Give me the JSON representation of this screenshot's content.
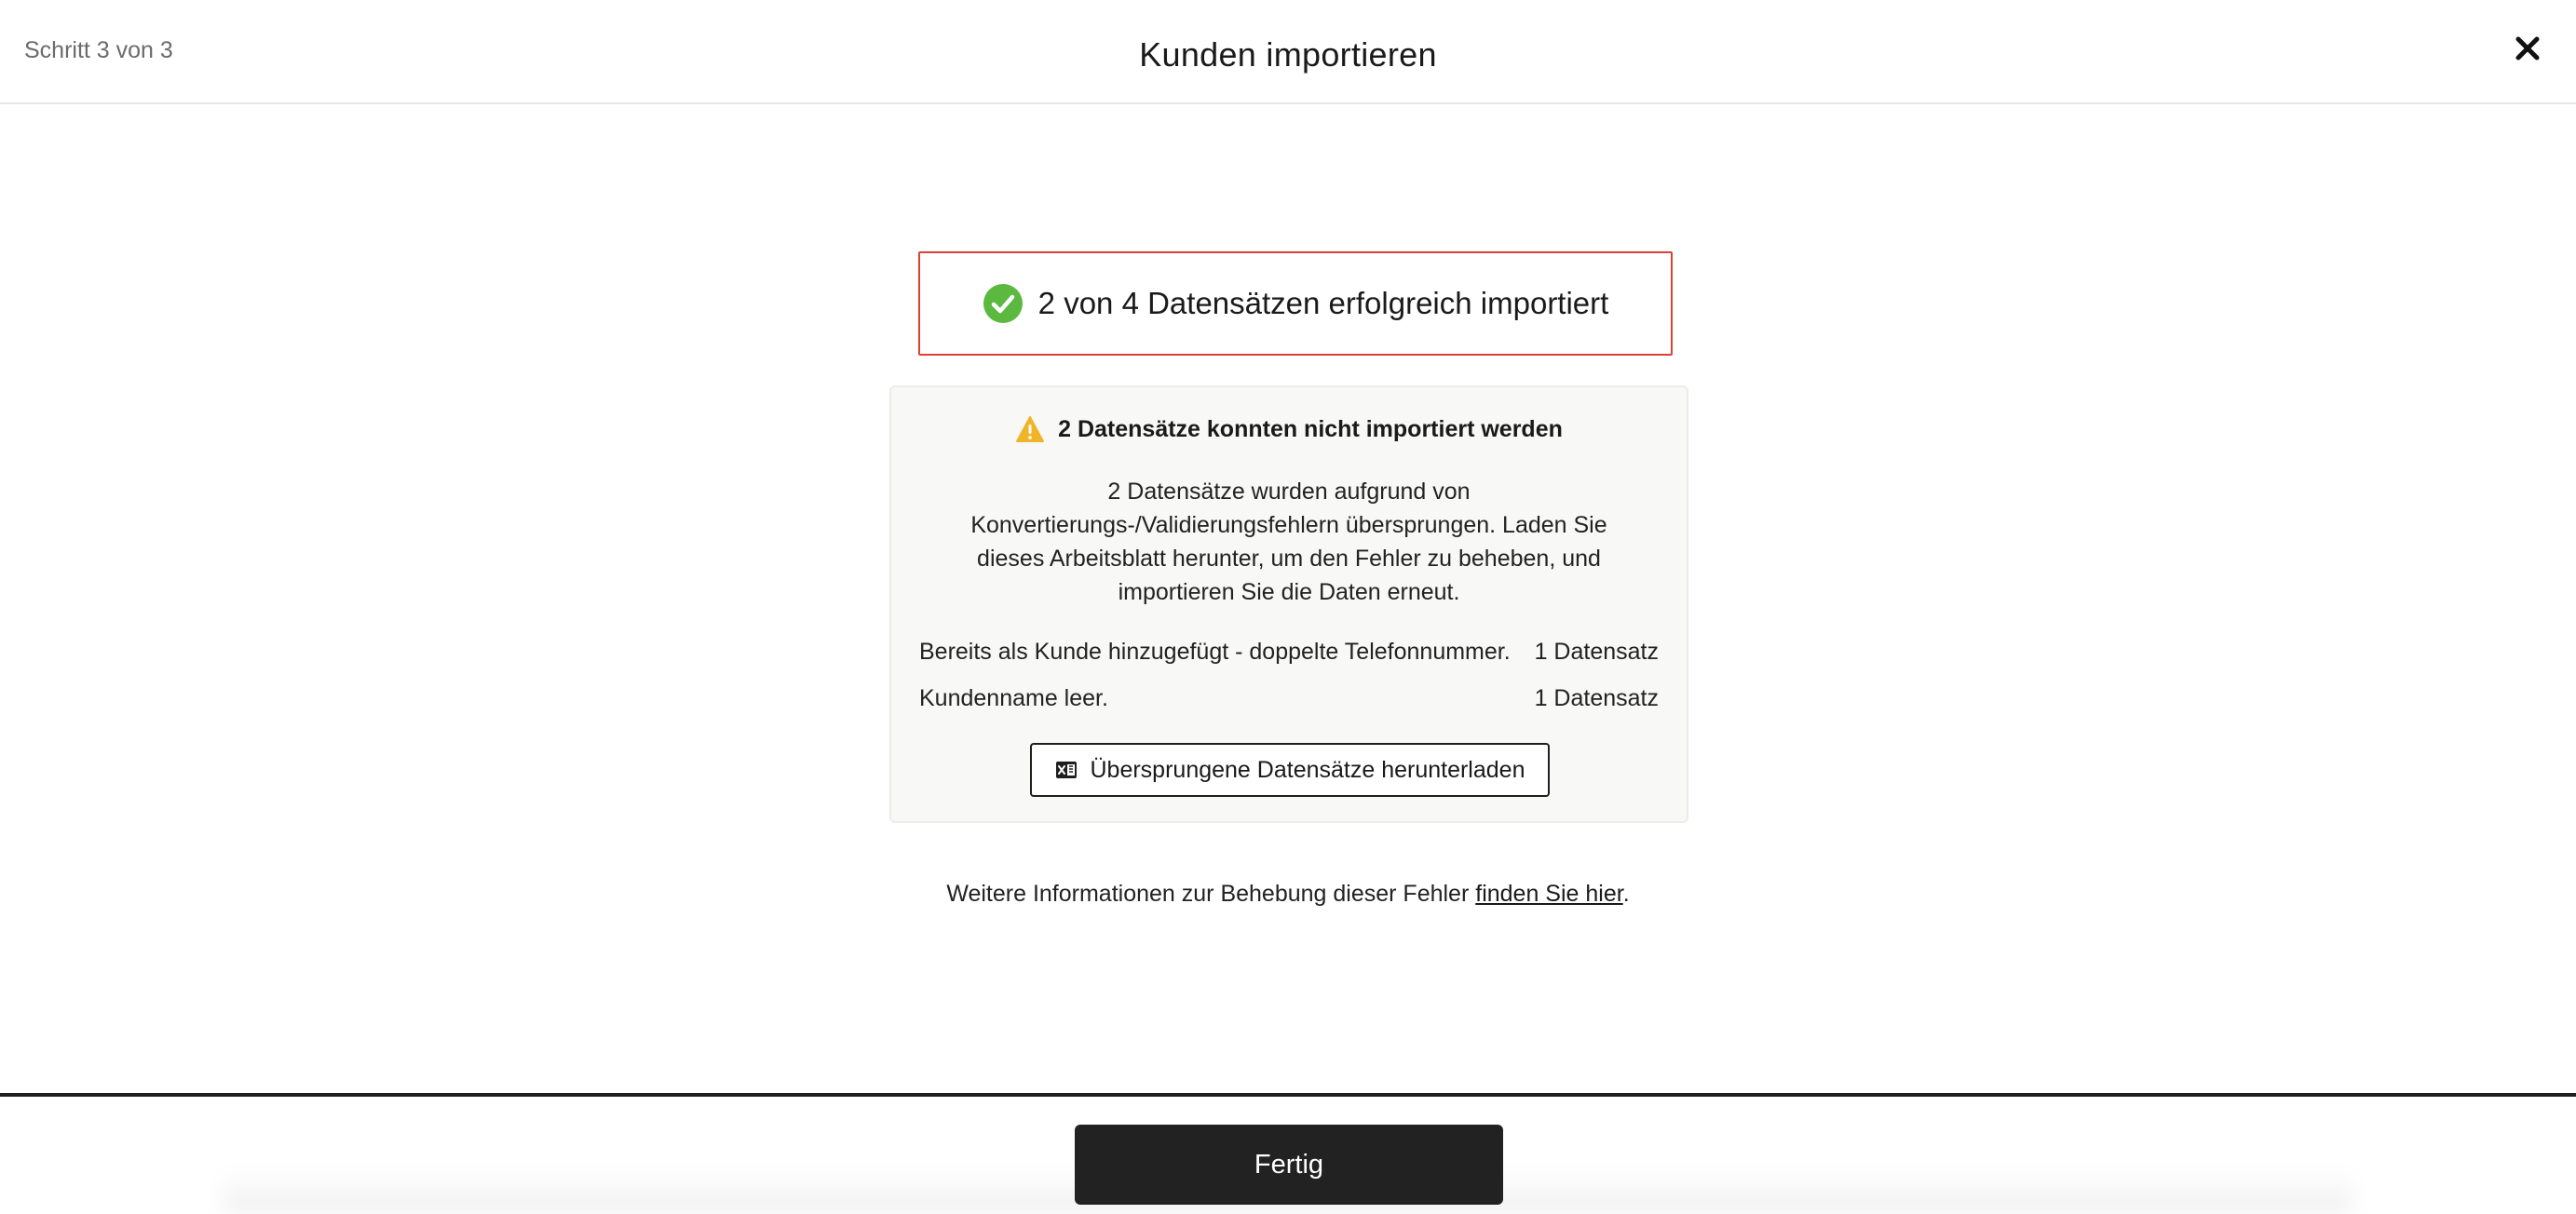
{
  "header": {
    "step": "Schritt 3 von 3",
    "title": "Kunden importieren",
    "close_icon": "close-icon"
  },
  "success": {
    "message": "2 von 4 Datensätzen erfolgreich importiert",
    "icon": "check-circle-icon",
    "icon_color": "#5bb93f",
    "border_color": "#d9413a"
  },
  "errors": {
    "icon": "warning-icon",
    "icon_color": "#f0b429",
    "title": "2 Datensätze konnten nicht importiert werden",
    "description_lines": [
      "2 Datensätze wurden aufgrund von",
      "Konvertierungs-/Validierungsfehlern übersprungen. Laden Sie",
      "dieses Arbeitsblatt herunter, um den Fehler zu beheben, und",
      "importieren Sie die Daten erneut."
    ],
    "rows": [
      {
        "reason": "Bereits als Kunde hinzugefügt - doppelte Telefonnummer.",
        "count": "1 Datensatz"
      },
      {
        "reason": "Kundenname leer.",
        "count": "1 Datensatz"
      }
    ],
    "download_button": "Übersprungene Datensätze herunterladen",
    "download_icon": "excel-file-icon"
  },
  "info": {
    "text": "Weitere Informationen zur Behebung dieser Fehler ",
    "link": "finden Sie hier",
    "suffix": "."
  },
  "footer": {
    "done_button": "Fertig"
  }
}
